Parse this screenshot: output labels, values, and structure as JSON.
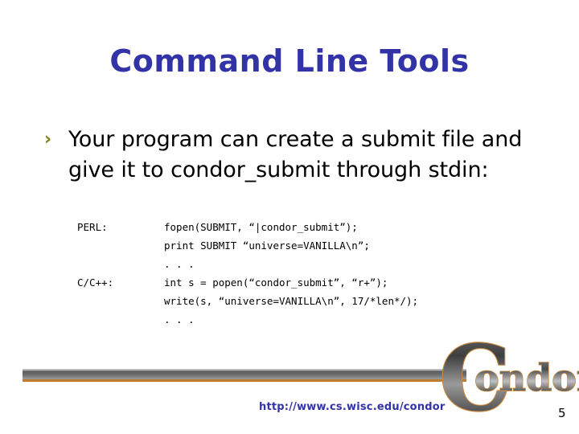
{
  "slide": {
    "title": "Command Line Tools",
    "page_number": "5",
    "title_color": "#3333a8",
    "bullet_marker": "›",
    "bullet_marker_color": "#7f7f18",
    "body_text": "Your program can create a submit file and give it to condor_submit through stdin:"
  },
  "code": {
    "rows": [
      {
        "label": "PERL:",
        "text": "fopen(SUBMIT, “|condor_submit”);"
      },
      {
        "label": "",
        "text": "print SUBMIT “universe=VANILLA\\n”;"
      },
      {
        "label": "",
        "text": ". . ."
      },
      {
        "label": "C/C++:",
        "text": "int s = popen(“condor_submit”, “r+”);"
      },
      {
        "label": "",
        "text": "write(s, “universe=VANILLA\\n”, 17/*len*/);"
      },
      {
        "label": "",
        "text": ". . ."
      }
    ]
  },
  "footer": {
    "url": "http://www.cs.wisc.edu/condor",
    "url_color": "#3333a8",
    "logo_text": "Condor",
    "logo_cap": "C",
    "logo_rest": "ondor",
    "bar_color_top": "#c3c3c3",
    "bar_color_mid": "#5e5e5e",
    "bar_accent_color": "#c07b2a",
    "logo_outline_color": "#c8873c",
    "logo_fill_dark": "#4a4a4a",
    "logo_fill_light": "#b8b8b8"
  }
}
